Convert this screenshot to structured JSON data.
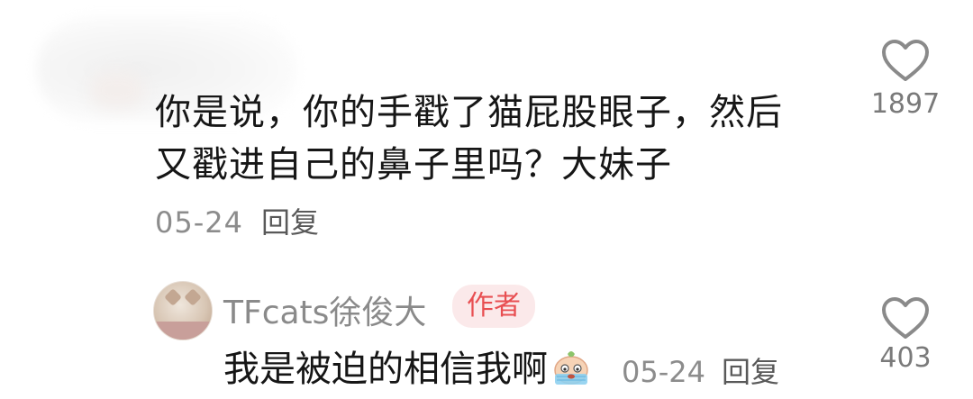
{
  "top_comment": {
    "text_line1": "你是说，你的手戳了猫屁股眼子，然后",
    "text_line2": "又戳进自己的鼻子里吗？大妹子",
    "date": "05-24",
    "reply_label": "回复",
    "like_count": "1897",
    "like_icon": "heart-outline-icon"
  },
  "reply_comment": {
    "username": "TFcats徐俊大",
    "badge": "作者",
    "text": "我是被迫的相信我啊",
    "emoji": "crying-face-emoji",
    "date": "05-24",
    "reply_label": "回复",
    "like_count": "403",
    "like_icon": "heart-outline-icon"
  },
  "colors": {
    "badge_text": "#e84f52",
    "badge_bg": "#fbe9ea",
    "muted_text": "#8c8c8c"
  }
}
